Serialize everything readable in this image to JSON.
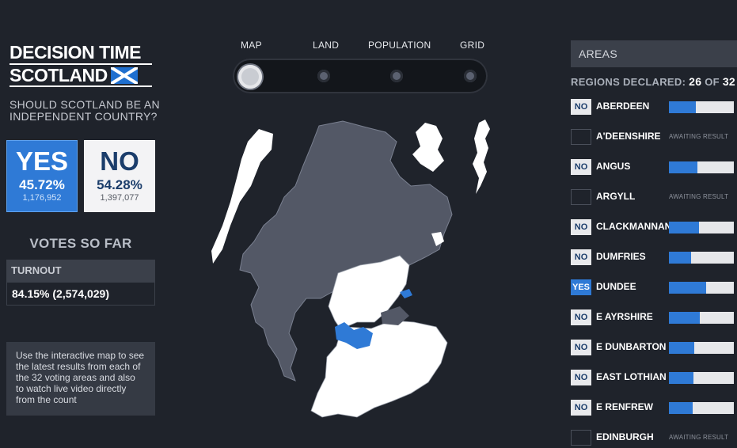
{
  "logo": {
    "line1": "DECISION TIME",
    "line2": "SCOTLAND"
  },
  "question": "SHOULD SCOTLAND BE AN INDEPENDENT COUNTRY?",
  "yes": {
    "label": "YES",
    "percent": "45.72%",
    "votes": "1,176,952",
    "color": "#2f7ad6"
  },
  "no": {
    "label": "NO",
    "percent": "54.28%",
    "votes": "1,397,077",
    "color": "#f3f3f5"
  },
  "votes_so_far": "VOTES SO FAR",
  "turnout": {
    "label": "TURNOUT",
    "value": "84.15% (2,574,029)"
  },
  "info_text": "Use the interactive map to see the latest results from each of the 32 voting areas and also to watch live video directly from the count",
  "views": [
    {
      "label": "MAP",
      "active": true
    },
    {
      "label": "LAND",
      "active": false
    },
    {
      "label": "POPULATION",
      "active": false
    },
    {
      "label": "GRID",
      "active": false
    }
  ],
  "areas": {
    "title": "AREAS",
    "declared_label": "REGIONS DECLARED:",
    "declared_count": "26",
    "of_label": "OF",
    "total": "32",
    "awaiting_text": "AWAITING RESULT",
    "rows": [
      {
        "result": "NO",
        "name": "ABERDEEN",
        "yes_share": 0.41
      },
      {
        "result": "",
        "name": "A'DEENSHIRE",
        "yes_share": null
      },
      {
        "result": "NO",
        "name": "ANGUS",
        "yes_share": 0.44
      },
      {
        "result": "",
        "name": "ARGYLL",
        "yes_share": null
      },
      {
        "result": "NO",
        "name": "CLACKMANNAN",
        "yes_share": 0.46
      },
      {
        "result": "NO",
        "name": "DUMFRIES",
        "yes_share": 0.34
      },
      {
        "result": "YES",
        "name": "DUNDEE",
        "yes_share": 0.57
      },
      {
        "result": "NO",
        "name": "E AYRSHIRE",
        "yes_share": 0.47
      },
      {
        "result": "NO",
        "name": "E DUNBARTON",
        "yes_share": 0.39
      },
      {
        "result": "NO",
        "name": "EAST LOTHIAN",
        "yes_share": 0.38
      },
      {
        "result": "NO",
        "name": "E RENFREW",
        "yes_share": 0.37
      },
      {
        "result": "",
        "name": "EDINBURGH",
        "yes_share": null
      }
    ]
  },
  "colors": {
    "yes": "#2f7ad6",
    "no": "#ffffff",
    "undeclared": "#535866",
    "background": "#1f232b"
  }
}
